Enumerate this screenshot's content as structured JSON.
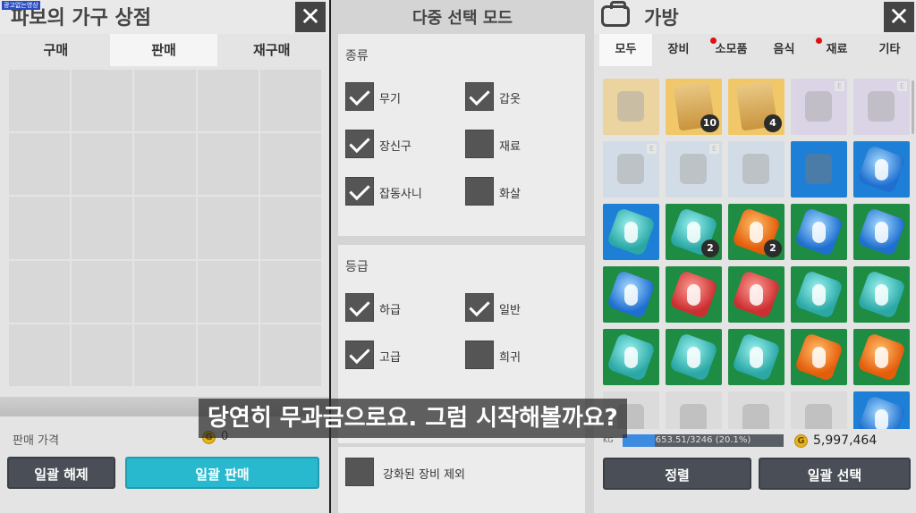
{
  "watermark": "광고없는영상",
  "shop": {
    "title": "파보의 가구 상점",
    "tabs": [
      "구매",
      "판매",
      "재구매"
    ],
    "active_tab": 1,
    "price_label": "판매 가격",
    "price_value": "0",
    "coin_symbol": "G",
    "buttons": {
      "deselect_all": "일괄 해제",
      "sell_all": "일괄 판매"
    }
  },
  "multi_select": {
    "title": "다중 선택 모드",
    "category": {
      "title": "종류",
      "options": [
        {
          "label": "무기",
          "checked": true
        },
        {
          "label": "갑옷",
          "checked": true
        },
        {
          "label": "장신구",
          "checked": true
        },
        {
          "label": "재료",
          "checked": false
        },
        {
          "label": "잡동사니",
          "checked": true
        },
        {
          "label": "화살",
          "checked": false
        }
      ]
    },
    "grade": {
      "title": "등급",
      "options": [
        {
          "label": "하급",
          "checked": true
        },
        {
          "label": "일반",
          "checked": true
        },
        {
          "label": "고급",
          "checked": true
        },
        {
          "label": "희귀",
          "checked": false
        }
      ]
    },
    "exclude_enhanced": {
      "label": "강화된 장비 제외",
      "checked": false
    }
  },
  "bag": {
    "title": "가방",
    "tabs": [
      {
        "label": "모두",
        "dot": false
      },
      {
        "label": "장비",
        "dot": false
      },
      {
        "label": "소모품",
        "dot": true
      },
      {
        "label": "음식",
        "dot": false
      },
      {
        "label": "재료",
        "dot": true
      },
      {
        "label": "기타",
        "dot": false
      }
    ],
    "active_tab": 0,
    "items": [
      {
        "bg": "gold",
        "kind": "shape",
        "faded": true,
        "count": ""
      },
      {
        "bg": "gold",
        "kind": "scroll",
        "faded": false,
        "count": "10"
      },
      {
        "bg": "gold",
        "kind": "scroll",
        "faded": false,
        "count": "4"
      },
      {
        "bg": "purple",
        "kind": "shape",
        "faded": true,
        "count": "",
        "e": true
      },
      {
        "bg": "purple",
        "kind": "shape",
        "faded": true,
        "count": "",
        "e": true
      },
      {
        "bg": "pale",
        "kind": "shape",
        "faded": true,
        "count": "",
        "e": true
      },
      {
        "bg": "pale",
        "kind": "shape",
        "faded": true,
        "count": "",
        "e": true
      },
      {
        "bg": "pale",
        "kind": "shape",
        "faded": true,
        "count": ""
      },
      {
        "bg": "blue",
        "kind": "shape",
        "faded": false,
        "count": ""
      },
      {
        "bg": "blue",
        "kind": "gem-blue",
        "faded": false,
        "count": ""
      },
      {
        "bg": "blue",
        "kind": "gem-cyan",
        "faded": false,
        "count": ""
      },
      {
        "bg": "green",
        "kind": "gem-cyan",
        "faded": false,
        "count": "2"
      },
      {
        "bg": "green",
        "kind": "gem-orange",
        "faded": false,
        "count": "2"
      },
      {
        "bg": "green",
        "kind": "gem-blue",
        "faded": false,
        "count": ""
      },
      {
        "bg": "green",
        "kind": "gem-blue",
        "faded": false,
        "count": ""
      },
      {
        "bg": "green",
        "kind": "gem-blue",
        "faded": false,
        "count": ""
      },
      {
        "bg": "green",
        "kind": "gem-red",
        "faded": false,
        "count": ""
      },
      {
        "bg": "green",
        "kind": "gem-red",
        "faded": false,
        "count": ""
      },
      {
        "bg": "green",
        "kind": "gem-cyan",
        "faded": false,
        "count": ""
      },
      {
        "bg": "green",
        "kind": "gem-cyan",
        "faded": false,
        "count": ""
      },
      {
        "bg": "green",
        "kind": "gem-cyan",
        "faded": false,
        "count": ""
      },
      {
        "bg": "green",
        "kind": "gem-cyan",
        "faded": false,
        "count": ""
      },
      {
        "bg": "green",
        "kind": "gem-cyan",
        "faded": false,
        "count": ""
      },
      {
        "bg": "green",
        "kind": "gem-orange",
        "faded": false,
        "count": ""
      },
      {
        "bg": "green",
        "kind": "gem-orange",
        "faded": false,
        "count": ""
      },
      {
        "bg": "gray",
        "kind": "shape",
        "faded": true,
        "count": ""
      },
      {
        "bg": "gray",
        "kind": "shape",
        "faded": true,
        "count": ""
      },
      {
        "bg": "gray",
        "kind": "shape",
        "faded": true,
        "count": ""
      },
      {
        "bg": "gray",
        "kind": "shape",
        "faded": true,
        "count": ""
      },
      {
        "bg": "blue",
        "kind": "gem-blue",
        "faded": false,
        "count": ""
      }
    ],
    "weight_label": "KG",
    "weight_text": "653.51/3246 (20.1%)",
    "weight_fraction": 0.201,
    "gold_symbol": "G",
    "gold_value": "5,997,464",
    "buttons": {
      "sort": "정렬",
      "select_all": "일괄 선택"
    }
  },
  "subtitle": "당연히 무과금으로요. 그럼 시작해볼까요?"
}
